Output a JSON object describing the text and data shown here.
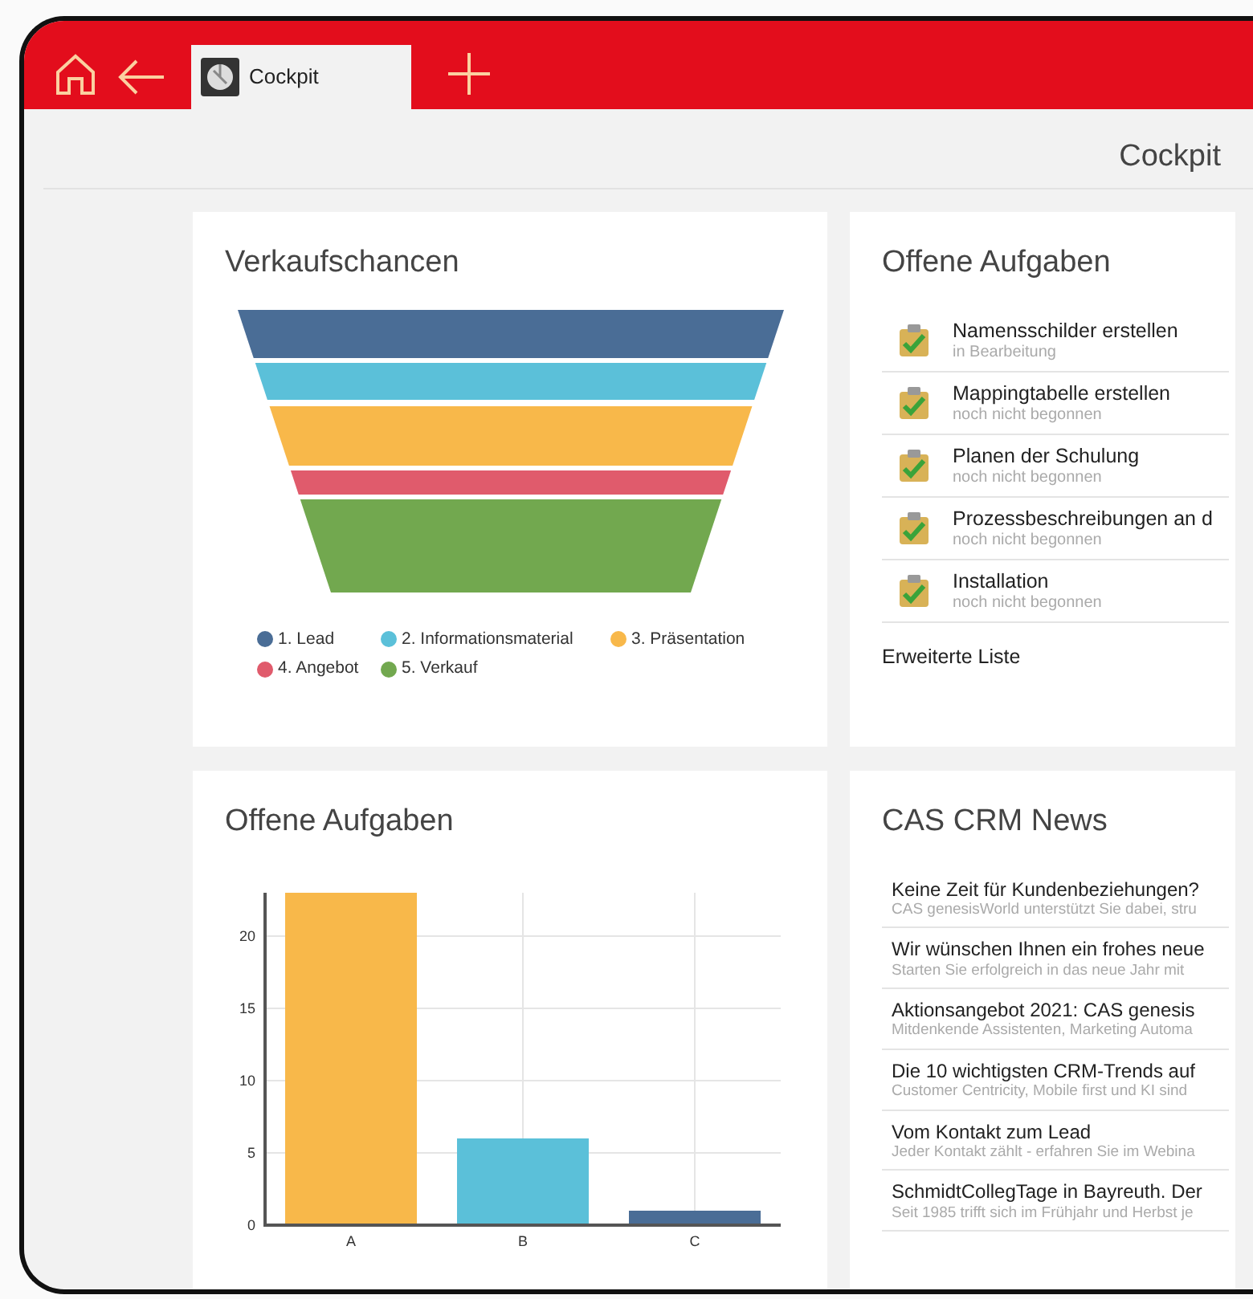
{
  "header": {
    "tabs": [
      {
        "label": "Cockpit",
        "selected": true
      }
    ]
  },
  "page_title": "Cockpit",
  "funnel_card": {
    "title": "Verkaufschancen",
    "legend": [
      {
        "label": "1. Lead",
        "color": "#4a6d96"
      },
      {
        "label": "2. Informationsmaterial",
        "color": "#5bc0d9"
      },
      {
        "label": "3. Präsentation",
        "color": "#f8b84a"
      },
      {
        "label": "4. Angebot",
        "color": "#e05b6c"
      },
      {
        "label": "5. Verkauf",
        "color": "#72a84f"
      }
    ]
  },
  "tasks_card": {
    "title": "Offene Aufgaben",
    "items": [
      {
        "title": "Namensschilder erstellen",
        "status": "in Bearbeitung"
      },
      {
        "title": "Mappingtabelle erstellen",
        "status": "noch nicht begonnen"
      },
      {
        "title": "Planen der Schulung",
        "status": "noch nicht begonnen"
      },
      {
        "title": "Prozessbeschreibungen an d",
        "status": "noch nicht begonnen"
      },
      {
        "title": "Installation",
        "status": "noch nicht begonnen"
      }
    ],
    "more_link": "Erweiterte Liste"
  },
  "chart_card": {
    "title": "Offene Aufgaben",
    "chart_data": {
      "type": "bar",
      "categories": [
        "A",
        "B",
        "C"
      ],
      "values": [
        23,
        6,
        1
      ],
      "grid": true,
      "colors": [
        "#f8b84a",
        "#5bc0d9",
        "#4a6d96"
      ],
      "ylim": [
        0,
        23
      ],
      "yticks": [
        0,
        5,
        10,
        15,
        20
      ]
    }
  },
  "news_card": {
    "title": "CAS CRM News",
    "items": [
      {
        "title": "Keine Zeit für Kundenbeziehungen?",
        "text": "CAS genesisWorld unterstützt Sie dabei, stru"
      },
      {
        "title": "Wir wünschen Ihnen ein frohes neue",
        "text": "Starten Sie erfolgreich in das neue Jahr mit"
      },
      {
        "title": "Aktionsangebot 2021: CAS genesis",
        "text": "Mitdenkende Assistenten, Marketing Automa"
      },
      {
        "title": "Die 10 wichtigsten CRM-Trends auf",
        "text": "Customer Centricity, Mobile first und KI sind"
      },
      {
        "title": "Vom Kontakt zum Lead",
        "text": "Jeder Kontakt zählt - erfahren Sie im Webina"
      },
      {
        "title": "SchmidtCollegTage in Bayreuth. Der",
        "text": "Seit 1985 trifft sich im Frühjahr und Herbst je"
      }
    ]
  }
}
